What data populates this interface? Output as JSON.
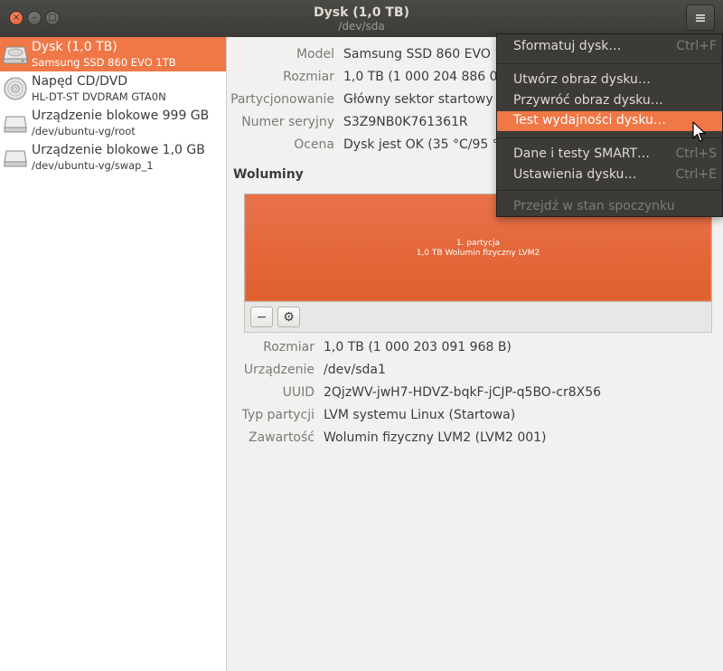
{
  "window": {
    "title": "Dysk (1,0 TB)",
    "subtitle": "/dev/sda",
    "close_glyph": "×",
    "minimize_glyph": "–",
    "maximize_glyph": "□",
    "menu_icon": "hamburger-menu-icon"
  },
  "sidebar": {
    "items": [
      {
        "name": "Dysk (1,0 TB)",
        "sub": "Samsung SSD 860 EVO 1TB",
        "icon": "hard-disk-icon",
        "selected": true
      },
      {
        "name": "Napęd CD/DVD",
        "sub": "HL-DT-ST DVDRAM GTA0N",
        "icon": "optical-disc-icon",
        "selected": false
      },
      {
        "name": "Urządzenie blokowe 999 GB",
        "sub": "/dev/ubuntu-vg/root",
        "icon": "block-device-icon",
        "selected": false
      },
      {
        "name": "Urządzenie blokowe 1,0 GB",
        "sub": "/dev/ubuntu-vg/swap_1",
        "icon": "block-device-icon",
        "selected": false
      }
    ]
  },
  "disk_info": {
    "model_label": "Model",
    "model_value": "Samsung SSD 860 EVO 1TB",
    "size_label": "Rozmiar",
    "size_value": "1,0 TB (1 000 204 886 016 B)",
    "partitioning_label": "Partycjonowanie",
    "partitioning_value": "Główny sektor startowy",
    "serial_label": "Numer seryjny",
    "serial_value": "S3Z9NB0K761361R",
    "assessment_label": "Ocena",
    "assessment_value": "Dysk jest OK (35 °C/95 °F)"
  },
  "volumes": {
    "heading": "Woluminy",
    "partition_line1": "1. partycja",
    "partition_line2": "1,0 TB Wolumin fizyczny LVM2",
    "remove_glyph": "−",
    "settings_glyph": "⚙",
    "size_label": "Rozmiar",
    "size_value": "1,0 TB (1 000 203 091 968 B)",
    "device_label": "Urządzenie",
    "device_value": "/dev/sda1",
    "uuid_label": "UUID",
    "uuid_value": "2QjzWV-jwH7-HDVZ-bqkF-jCJP-q5BO-cr8X56",
    "parttype_label": "Typ partycji",
    "parttype_value": "LVM systemu Linux (Startowa)",
    "contents_label": "Zawartość",
    "contents_value": "Wolumin fizyczny LVM2 (LVM2 001)"
  },
  "menu": {
    "items": [
      {
        "label": "Sformatuj dysk…",
        "shortcut": "Ctrl+F"
      },
      {
        "label": "Utwórz obraz dysku…",
        "shortcut": ""
      },
      {
        "label": "Przywróć obraz dysku…",
        "shortcut": ""
      },
      {
        "label": "Test wydajności dysku…",
        "shortcut": "",
        "highlighted": true
      },
      {
        "label": "Dane i testy SMART…",
        "shortcut": "Ctrl+S"
      },
      {
        "label": "Ustawienia dysku…",
        "shortcut": "Ctrl+E"
      },
      {
        "label": "Przejdź w stan spoczynku",
        "shortcut": "",
        "disabled": true
      }
    ]
  },
  "colors": {
    "accent": "#f07746",
    "titlebar": "#3c3b37",
    "menu_bg": "#3c3b37"
  }
}
